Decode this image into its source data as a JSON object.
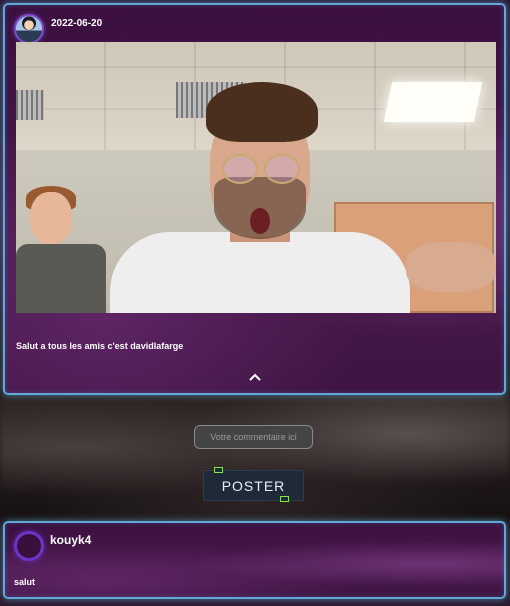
{
  "post": {
    "date": "2022-06-20",
    "text": "Salut a tous les amis c'est davidlafarge"
  },
  "comment_form": {
    "placeholder": "Votre commentaire ici",
    "submit_label": "POSTER"
  },
  "comments": [
    {
      "username": "kouyk4",
      "text": "salut"
    }
  ],
  "colors": {
    "card_border": "#5fa8d8",
    "card_background": "#3b0f3f",
    "button_background": "#1f2a38",
    "avatar_ring": "#6a35c8"
  },
  "icons": {
    "collapse": "chevron-up-icon"
  }
}
